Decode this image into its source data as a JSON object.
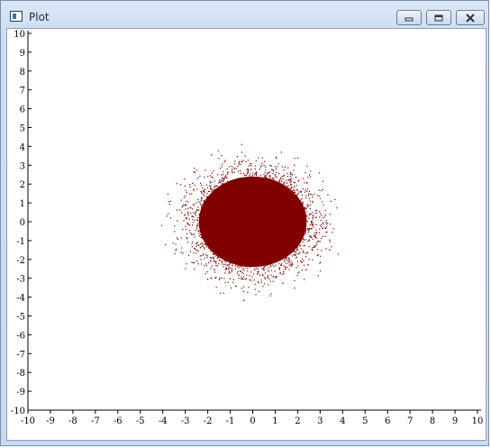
{
  "window": {
    "title": "Plot",
    "controls": {
      "minimize_icon": "minimize-icon",
      "maximize_icon": "maximize-icon",
      "close_icon": "close-icon"
    }
  },
  "chart_data": {
    "type": "scatter",
    "title": "",
    "xlabel": "",
    "ylabel": "",
    "xlim": [
      -10,
      10
    ],
    "ylim": [
      -10,
      10
    ],
    "x_ticks": [
      -10,
      -9,
      -8,
      -7,
      -6,
      -5,
      -4,
      -3,
      -2,
      -1,
      0,
      1,
      2,
      3,
      4,
      5,
      6,
      7,
      8,
      9,
      10
    ],
    "y_ticks": [
      10,
      9,
      8,
      7,
      6,
      5,
      4,
      3,
      2,
      1,
      0,
      -1,
      -2,
      -3,
      -4,
      -5,
      -6,
      -7,
      -8,
      -9,
      -10
    ],
    "grid": false,
    "series": [
      {
        "color": "#800000",
        "distribution": "dense cloud of points centered near (0, 0), std ≈ 1, extending to about ±3.5 in x and ±3.5 in y",
        "center": [
          0,
          0
        ],
        "spread": 1
      }
    ]
  }
}
